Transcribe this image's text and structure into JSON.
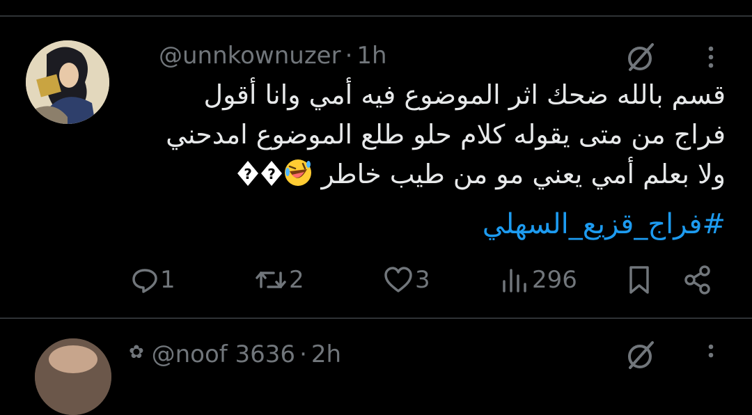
{
  "tweet": {
    "username": "@unnkownuzer",
    "separator": "·",
    "time": "1h",
    "lines": [
      "قسم بالله ضحك اثر الموضوع فيه أمي وانا أقول",
      "فراج من متى يقوله كلام حلو طلع الموضوع امدحني",
      "ولا بعلم أمي يعني مو من طيب خاطر"
    ],
    "emoji_name": "rolling-on-the-floor-laughing-emoji",
    "replacement_chars": [
      "�",
      "�"
    ],
    "hashtag": "#فراج_قزيع_السهلي",
    "actions": {
      "replies": "1",
      "reposts": "2",
      "likes": "3",
      "views": "296"
    }
  },
  "next_tweet": {
    "username": "@noof 3636",
    "separator": "·",
    "time": "2h"
  },
  "colors": {
    "background": "#000000",
    "text": "#e7e9ea",
    "muted": "#71767b",
    "link": "#1d9bf0",
    "divider": "#2f3336"
  }
}
